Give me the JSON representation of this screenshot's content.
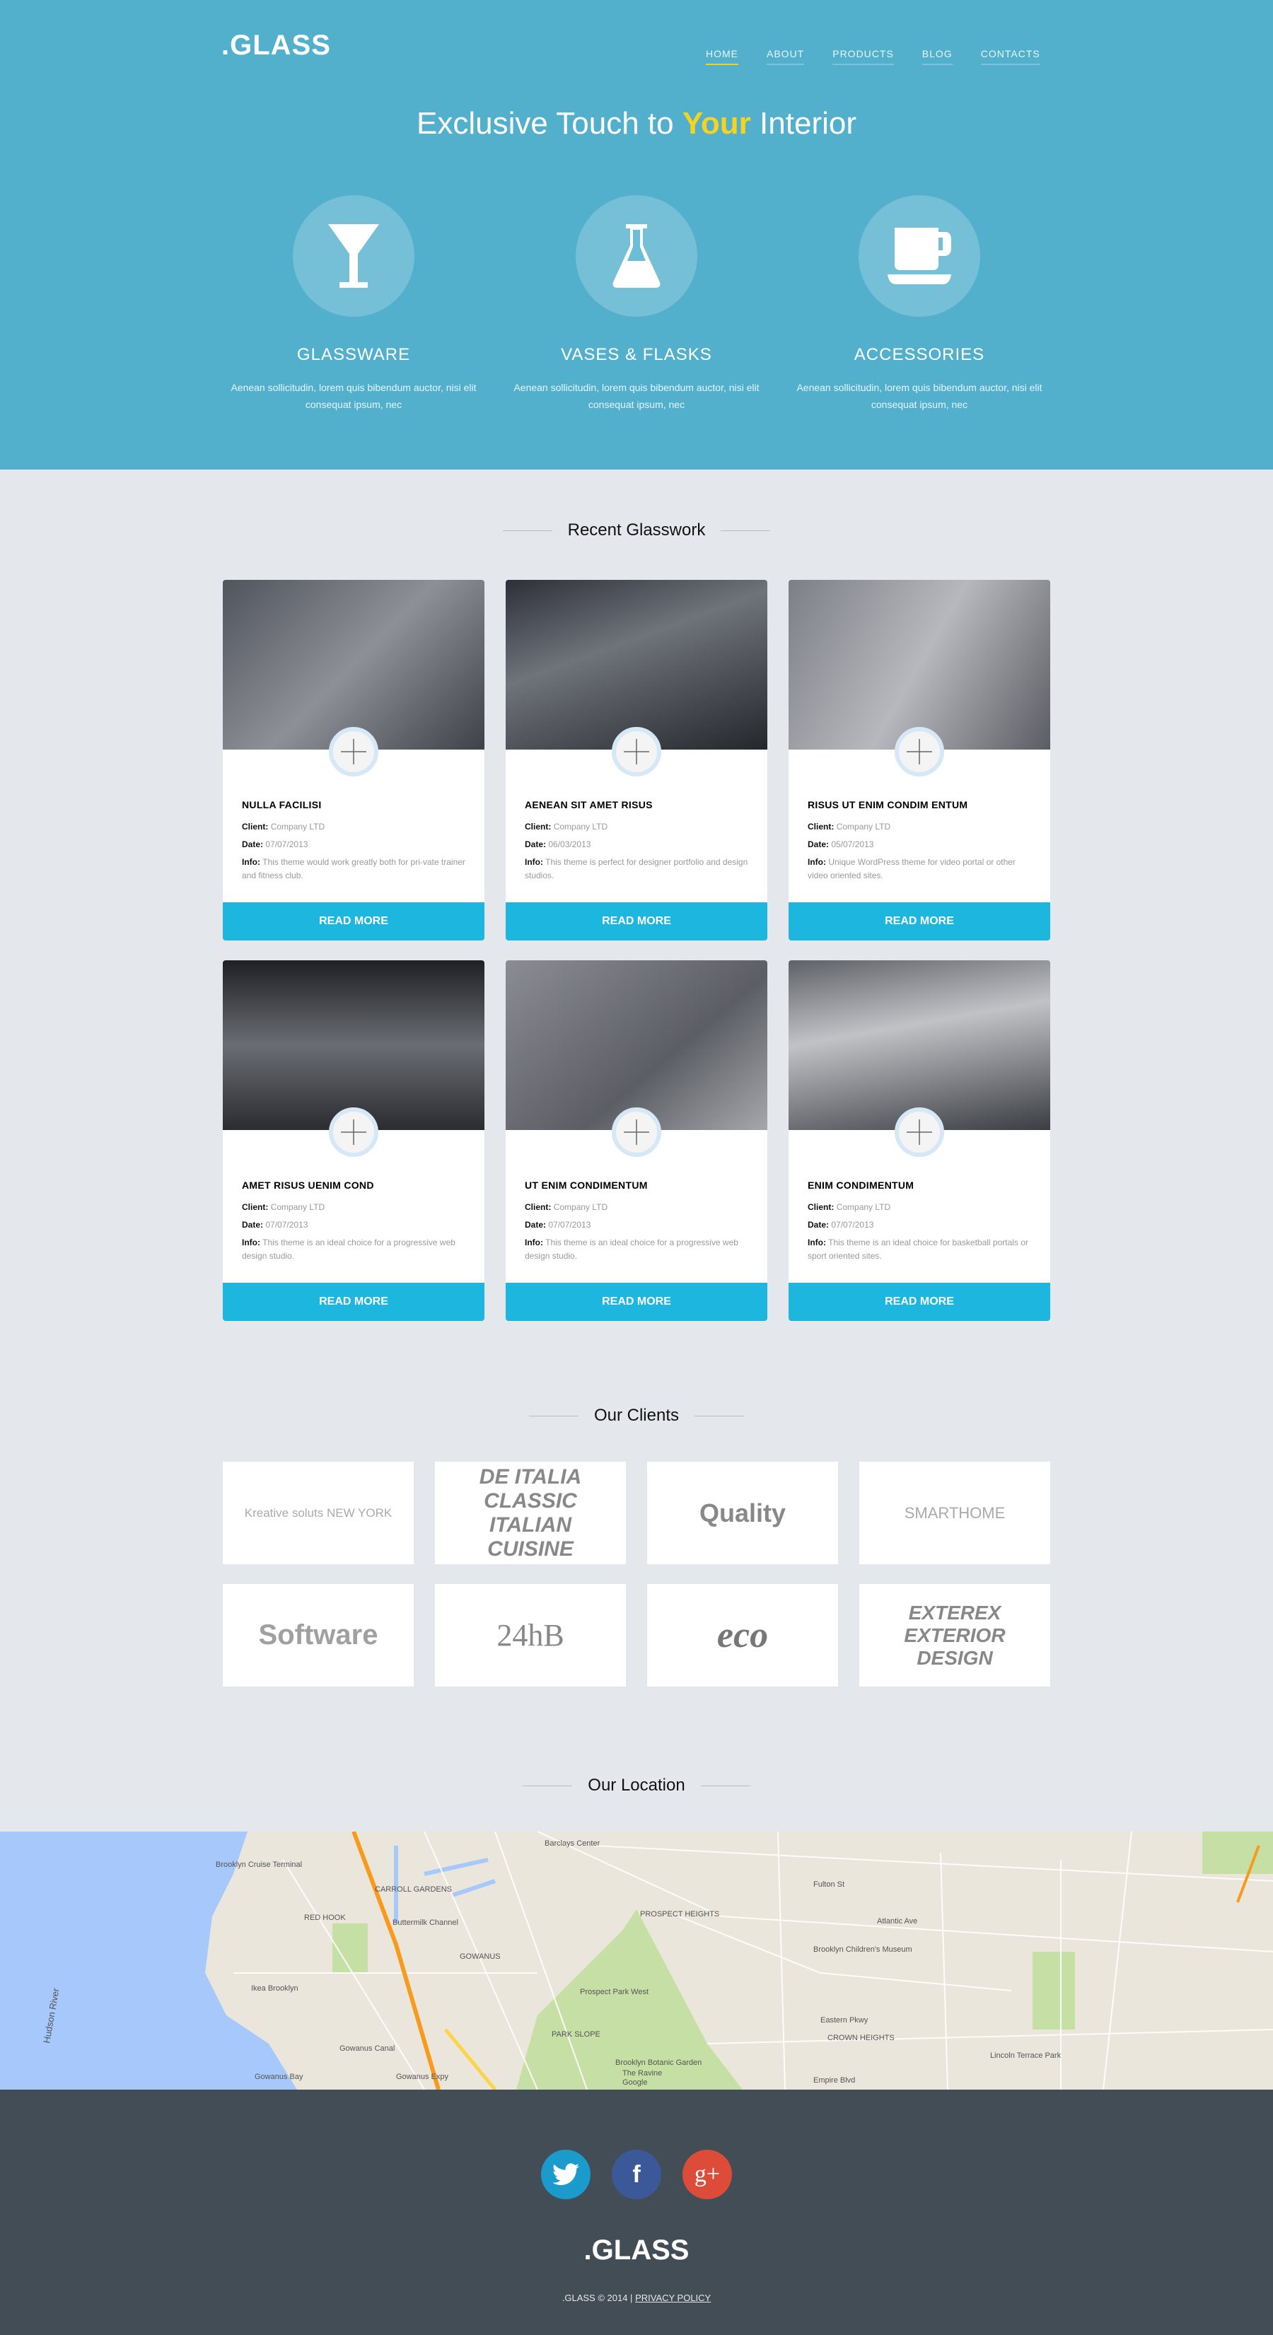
{
  "header": {
    "logo": ".GLASS",
    "nav": [
      {
        "label": "HOME",
        "active": true
      },
      {
        "label": "ABOUT"
      },
      {
        "label": "PRODUCTS"
      },
      {
        "label": "BLOG"
      },
      {
        "label": "CONTACTS"
      }
    ],
    "headline_pre": "Exclusive Touch to",
    "headline_highlight": "Your",
    "headline_post": "Interior",
    "highlight_color": "#f7d31d",
    "bg_color": "#53b0cd"
  },
  "categories": [
    {
      "icon": "martini-glass-icon",
      "title": "GLASSWARE",
      "text": "Aenean sollicitudin, lorem quis bibendum auctor, nisi elit consequat ipsum, nec"
    },
    {
      "icon": "flask-icon",
      "title": "VASES & FLASKS",
      "text": "Aenean sollicitudin, lorem quis bibendum auctor, nisi elit consequat ipsum, nec"
    },
    {
      "icon": "coffee-cup-icon",
      "title": "ACCESSORIES",
      "text": "Aenean sollicitudin, lorem quis bibendum auctor, nisi elit consequat ipsum, nec"
    }
  ],
  "work": {
    "title": "Recent Glasswork",
    "client_label": "Client:",
    "date_label": "Date:",
    "info_label": "Info:",
    "button": "READ MORE",
    "accent": "#1cb6de",
    "items": [
      {
        "title": "NULLA FACILISI",
        "client": "Company LTD",
        "date": "07/07/2013",
        "info": "This theme would work greatly both for pri-vate trainer and fitness club."
      },
      {
        "title": "AENEAN SIT AMET RISUS",
        "client": "Company LTD",
        "date": "06/03/2013",
        "info": "This theme is perfect for designer portfolio and design studios."
      },
      {
        "title": "RISUS UT ENIM CONDIM ENTUM",
        "client": "Company LTD",
        "date": "05/07/2013",
        "info": "Unique WordPress theme for video portal or other video oriented sites."
      },
      {
        "title": "AMET RISUS UENIM COND",
        "client": "Company LTD",
        "date": "07/07/2013",
        "info": "This theme is an ideal choice for a progressive web design studio."
      },
      {
        "title": "UT ENIM CONDIMENTUM",
        "client": "Company LTD",
        "date": "07/07/2013",
        "info": "This theme is an ideal choice for a progressive web design studio."
      },
      {
        "title": "ENIM CONDIMENTUM",
        "client": "Company LTD",
        "date": "07/07/2013",
        "info": "This theme is an ideal choice for basketball portals or sport oriented sites."
      }
    ]
  },
  "clients": {
    "title": "Our Clients",
    "logos": [
      "Kreative soluts NEW YORK",
      "DE ITALIA CLASSIC ITALIAN CUISINE",
      "Quality",
      "SMARTHOME",
      "Software",
      "24hB",
      "eco",
      "EXTEREX EXTERIOR DESIGN"
    ]
  },
  "location": {
    "title": "Our Location",
    "labels": [
      "Barclays Center",
      "Brooklyn Cruise Terminal",
      "CARROLL GARDENS",
      "RED HOOK",
      "Buttermilk Channel",
      "GOWANUS",
      "PROSPECT HEIGHTS",
      "Brooklyn Children's Museum",
      "Atlantic Ave",
      "Fulton St",
      "Eastern Pkwy",
      "CROWN HEIGHTS",
      "PARK SLOPE",
      "Ikea Brooklyn",
      "Gowanus Canal",
      "Gowanus Bay",
      "Hudson River",
      "Brooklyn Botanic Garden",
      "The Ravine",
      "Lincoln Terrace Park",
      "Empire Blvd",
      "Prospect Park West",
      "Gowanus Expy",
      "Google"
    ]
  },
  "footer": {
    "social": [
      {
        "icon": "twitter-icon",
        "color": "#1b9bcb"
      },
      {
        "icon": "facebook-icon",
        "color": "#3b5998",
        "glyph": "f"
      },
      {
        "icon": "google-plus-icon",
        "color": "#dd4b39",
        "glyph": "g+"
      }
    ],
    "logo": ".GLASS",
    "copyright": ".GLASS © 2014 |",
    "privacy": "PRIVACY POLICY",
    "bg_color": "#434d56"
  }
}
